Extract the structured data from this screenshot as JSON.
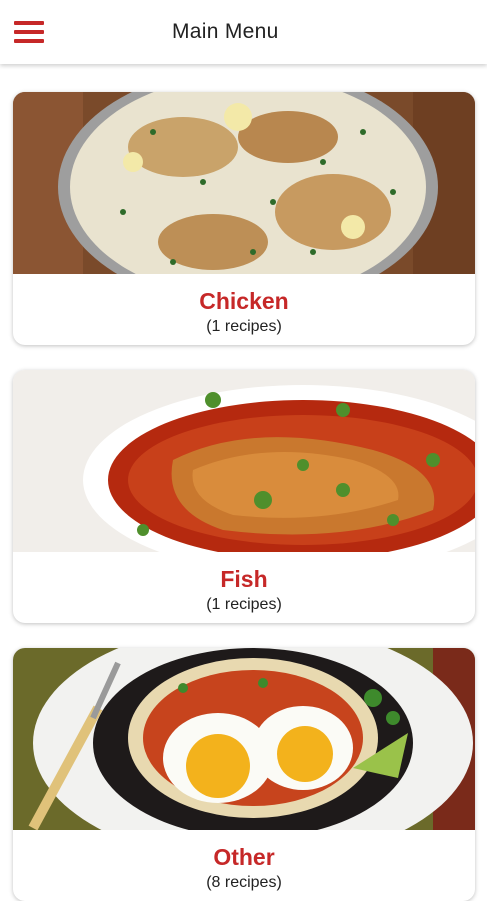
{
  "header": {
    "title": "Main Menu",
    "menu_icon": "hamburger-menu-icon"
  },
  "colors": {
    "accent": "#c62828",
    "text": "#222222"
  },
  "categories": [
    {
      "name": "Chicken",
      "count": "(1 recipes)",
      "image": "chicken-dish-image"
    },
    {
      "name": "Fish",
      "count": "(1 recipes)",
      "image": "fish-dish-image"
    },
    {
      "name": "Other",
      "count": "(8 recipes)",
      "image": "eggs-dish-image"
    }
  ]
}
